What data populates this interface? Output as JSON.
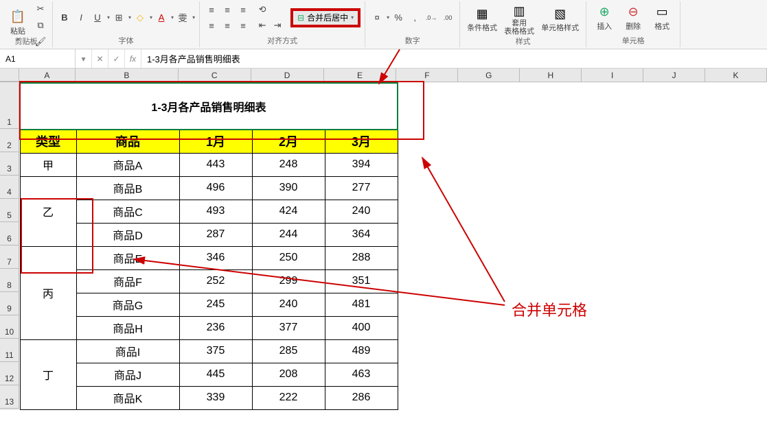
{
  "ribbon": {
    "clipboard": {
      "label": "剪贴板",
      "paste": "粘贴"
    },
    "font": {
      "label": "字体",
      "bold": "B",
      "italic": "I",
      "underline": "U"
    },
    "alignment": {
      "label": "对齐方式",
      "merge_center": "合并后居中"
    },
    "number": {
      "label": "数字",
      "percent": "%",
      "comma": ","
    },
    "styles": {
      "label": "样式",
      "cond_format": "条件格式",
      "table_format": "套用\n表格格式",
      "cell_style": "单元格样式"
    },
    "cells": {
      "label": "单元格",
      "insert": "插入",
      "delete": "删除",
      "format": "格式"
    }
  },
  "formula_bar": {
    "name_box": "A1",
    "formula": "1-3月各产品销售明细表"
  },
  "columns": [
    "A",
    "B",
    "C",
    "D",
    "E",
    "F",
    "G",
    "H",
    "I",
    "J",
    "K"
  ],
  "rows": [
    1,
    2,
    3,
    4,
    5,
    6,
    7,
    8,
    9,
    10,
    11,
    12,
    13
  ],
  "sheet": {
    "title": "1-3月各产品销售明细表",
    "headers": {
      "type": "类型",
      "product": "商品",
      "m1": "1月",
      "m2": "2月",
      "m3": "3月"
    },
    "groups": [
      {
        "type": "甲",
        "rows": [
          {
            "p": "商品A",
            "v": [
              443,
              248,
              394
            ]
          }
        ]
      },
      {
        "type": "乙",
        "rows": [
          {
            "p": "商品B",
            "v": [
              496,
              390,
              277
            ]
          },
          {
            "p": "商品C",
            "v": [
              493,
              424,
              240
            ]
          },
          {
            "p": "商品D",
            "v": [
              287,
              244,
              364
            ]
          }
        ]
      },
      {
        "type": "丙",
        "rows": [
          {
            "p": "商品E",
            "v": [
              346,
              250,
              288
            ]
          },
          {
            "p": "商品F",
            "v": [
              252,
              299,
              351
            ]
          },
          {
            "p": "商品G",
            "v": [
              245,
              240,
              481
            ]
          },
          {
            "p": "商品H",
            "v": [
              236,
              377,
              400
            ]
          }
        ]
      },
      {
        "type": "丁",
        "rows": [
          {
            "p": "商品I",
            "v": [
              375,
              285,
              489
            ]
          },
          {
            "p": "商品J",
            "v": [
              445,
              208,
              463
            ]
          },
          {
            "p": "商品K",
            "v": [
              339,
              222,
              286
            ]
          }
        ]
      }
    ]
  },
  "annotation": {
    "text": "合并单元格"
  }
}
